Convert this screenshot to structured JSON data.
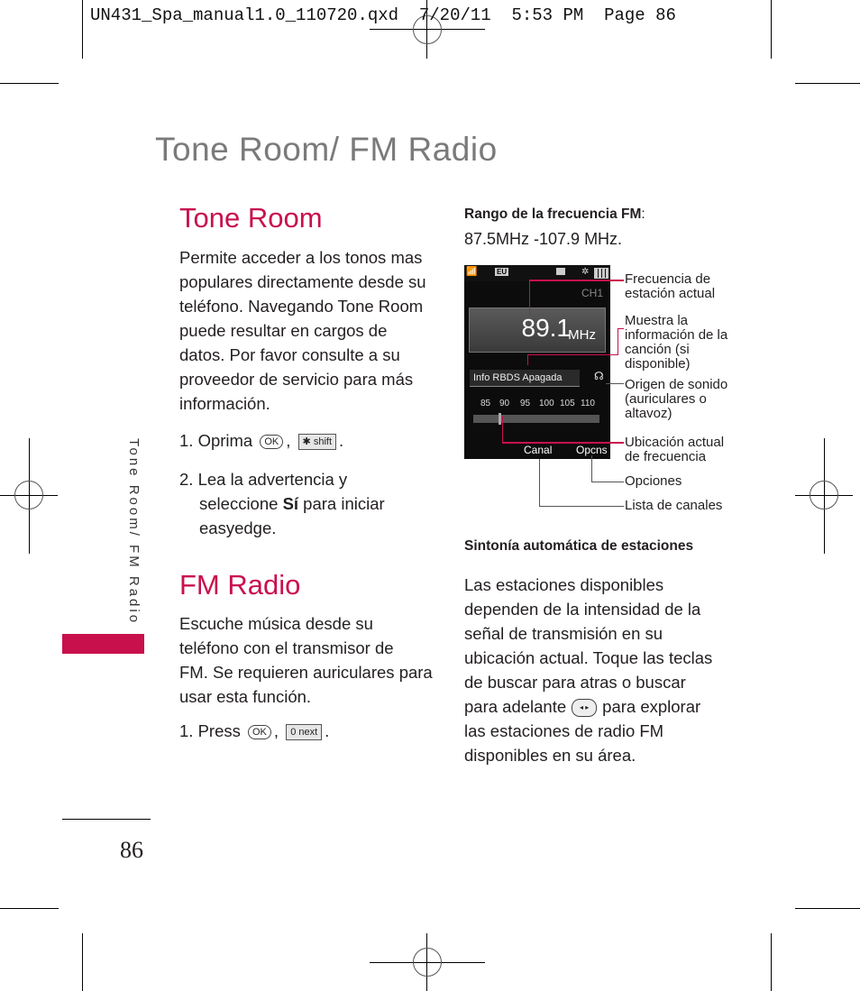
{
  "slug": "UN431_Spa_manual1.0_110720.qxd  7/20/11  5:53 PM  Page 86",
  "page_title": "Tone Room/ FM Radio",
  "sidebar_label": "Tone Room/ FM Radio",
  "page_number": "86",
  "accent_color": "#c8104d",
  "tone_room": {
    "heading": "Tone Room",
    "body": [
      "Permite acceder a los tonos mas",
      "populares directamente desde su",
      "teléfono. Navegando Tone Room",
      "puede resultar en cargos de",
      "datos. Por favor consulte a su",
      "proveedor de servicio para más",
      "información."
    ],
    "step1": {
      "prefix": "1. Oprima",
      "key1": "OK",
      "sep": ",",
      "key2": "✱ shift",
      "suffix": "."
    },
    "step2": {
      "line1": "2. Lea la advertencia y",
      "line2_pre": "seleccione ",
      "line2_bold": "Sí",
      "line2_post": " para iniciar",
      "line3": "easyedge."
    }
  },
  "fm_radio": {
    "heading": "FM Radio",
    "body": [
      "Escuche música desde su",
      "teléfono con el transmisor de",
      "FM. Se requieren auriculares para",
      "usar esta función."
    ],
    "step1": {
      "prefix": "1. Press",
      "key1": "OK",
      "sep": ",",
      "key2": "0 next",
      "suffix": "."
    }
  },
  "range": {
    "label": "Rango de la frecuencia FM",
    "colon": ":",
    "value": "87.5MHz -107.9 MHz."
  },
  "phone_screen": {
    "status_icons": [
      "signal-icon",
      "eu-icon",
      "radio-icon",
      "settings-icon",
      "battery-icon"
    ],
    "eu": "EU",
    "channel": "CH1",
    "frequency": "89.1",
    "unit": "MHz",
    "rbds": "Info RBDS Apagada",
    "scale_ticks": [
      "85",
      "90",
      "95",
      "100",
      "105",
      "110"
    ],
    "current_frequency_mhz": 89.1,
    "softkey_left": "Canal",
    "softkey_right": "Opcns"
  },
  "callouts": [
    {
      "text": [
        "Frecuencia de",
        "estación actual"
      ]
    },
    {
      "text": [
        "Muestra la",
        "información de la",
        "canción (si",
        "disponible)"
      ]
    },
    {
      "text": [
        "Origen de sonido",
        "(auriculares o",
        "altavoz)"
      ]
    },
    {
      "text": [
        "Ubicación actual",
        "de frecuencia"
      ]
    },
    {
      "text": [
        "Opciones"
      ]
    },
    {
      "text": [
        "Lista de canales"
      ]
    }
  ],
  "autotune": {
    "heading": "Sintonía automática de estaciones",
    "body": [
      "Las estaciones disponibles",
      "dependen de la intensidad de la",
      "señal de transmisión en su",
      "ubicación actual. Toque las teclas",
      "de buscar para atras o buscar"
    ],
    "line6_pre": "para adelante",
    "line6_post": "para explorar",
    "body_end": [
      "las estaciones de radio FM",
      "disponibles en su área."
    ]
  }
}
